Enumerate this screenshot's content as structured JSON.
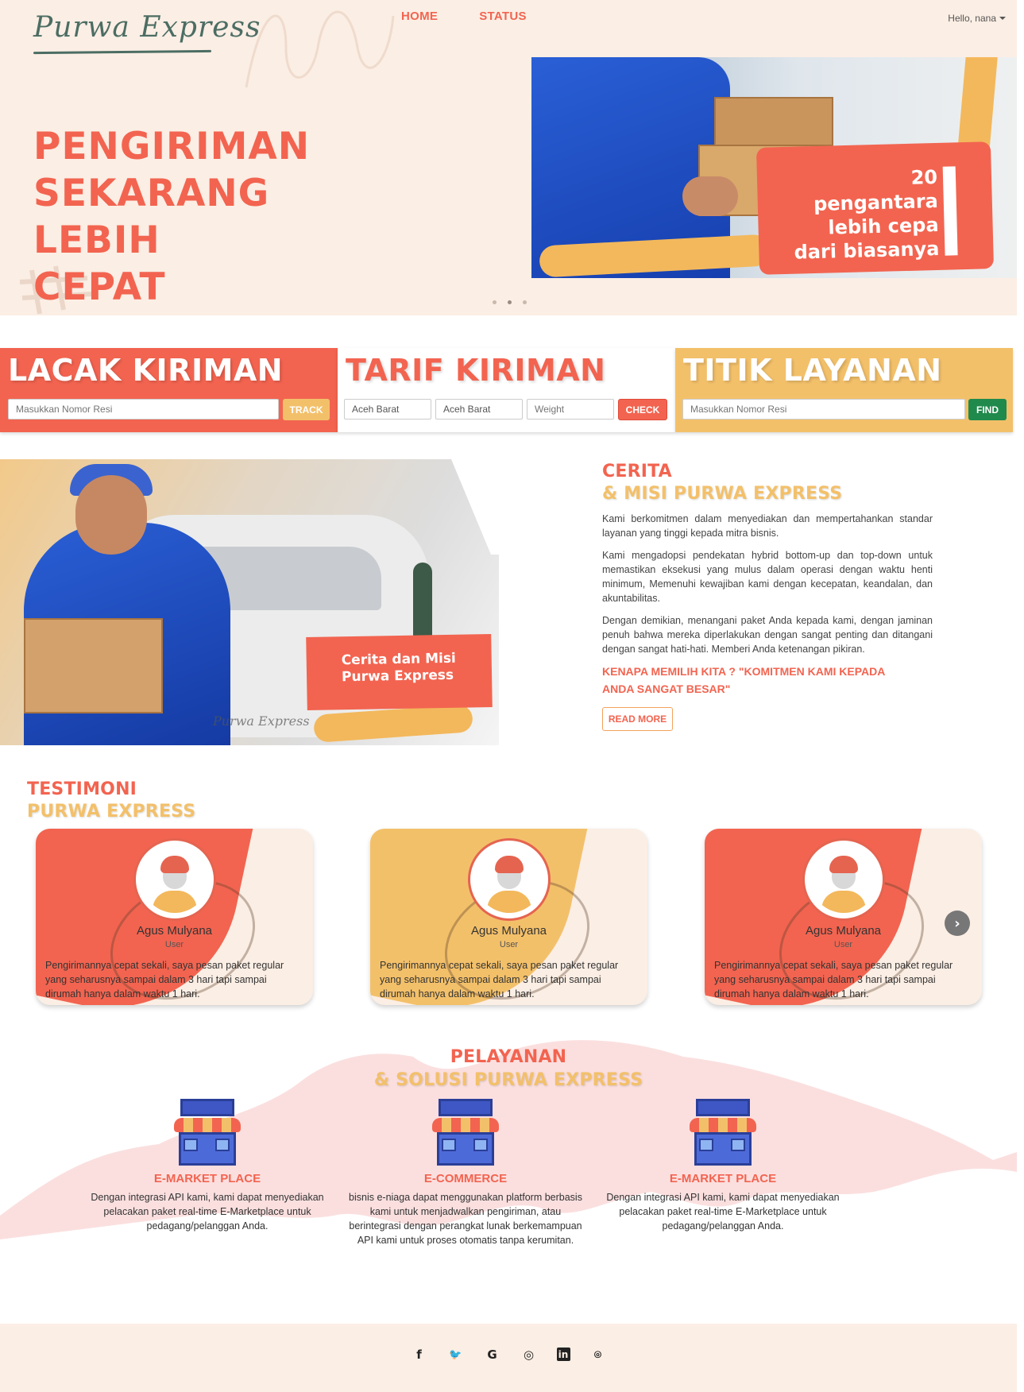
{
  "header": {
    "logo_text": "Purwa Express",
    "nav": [
      "HOME",
      "STATUS"
    ],
    "user_greeting": "Hello, nana"
  },
  "hero": {
    "title_lines": [
      "PENGIRIMAN",
      "SEKARANG LEBIH",
      "CEPAT"
    ],
    "card_text": "20\npengantara\nlebih cepa\ndari biasanya",
    "carousel_count": 3,
    "carousel_active": 1
  },
  "services": {
    "track": {
      "title": "LACAK KIRIMAN",
      "placeholder": "Masukkan Nomor Resi",
      "button": "TRACK"
    },
    "tarif": {
      "title": "TARIF KIRIMAN",
      "origin": "Aceh Barat",
      "destination": "Aceh Barat",
      "weight_placeholder": "Weight",
      "button": "CHECK"
    },
    "titik": {
      "title": "TITIK LAYANAN",
      "placeholder": "Masukkan Nomor Resi",
      "button": "FIND"
    }
  },
  "story": {
    "image_caption": "Cerita dan Misi\nPurwa Express",
    "image_signature": "Purwa Express",
    "title_line1": "CERITA",
    "title_line2": "& MISI PURWA EXPRESS",
    "paragraphs": [
      "Kami berkomitmen dalam menyediakan dan mempertahankan standar layanan yang tinggi kepada mitra bisnis.",
      "Kami mengadopsi pendekatan hybrid bottom-up dan top-down untuk memastikan eksekusi yang mulus dalam operasi dengan waktu henti minimum, Memenuhi kewajiban kami dengan kecepatan, keandalan, dan akuntabilitas.",
      "Dengan demikian, menangani paket Anda kepada kami, dengan jaminan penuh bahwa mereka diperlakukan dengan sangat penting dan ditangani dengan sangat hati-hati. Memberi Anda ketenangan pikiran."
    ],
    "why": "KENAPA MEMILIH KITA ? \"KOMITMEN KAMI KEPADA ANDA SANGAT BESAR\"",
    "read_more": "READ MORE"
  },
  "testimoni": {
    "title_line1": "TESTIMONI",
    "title_line2": "PURWA EXPRESS",
    "items": [
      {
        "name": "Agus Mulyana",
        "role": "User",
        "quote": "Pengirimannya cepat sekali, saya pesan paket regular yang seharusnya sampai dalam 3 hari tapi sampai dirumah hanya dalam waktu 1 hari.",
        "color": "#f26450"
      },
      {
        "name": "Agus Mulyana",
        "role": "User",
        "quote": "Pengirimannya cepat sekali, saya pesan paket regular yang seharusnya sampai dalam 3 hari tapi sampai dirumah hanya dalam waktu 1 hari.",
        "color": "#f3c06a"
      },
      {
        "name": "Agus Mulyana",
        "role": "User",
        "quote": "Pengirimannya cepat sekali, saya pesan paket regular yang seharusnya sampai dalam 3 hari tapi sampai dirumah hanya dalam waktu 1 hari.",
        "color": "#f26450"
      }
    ],
    "next_icon": "chevron-right-icon"
  },
  "pelayanan": {
    "title_line1": "PELAYANAN",
    "title_line2": "& SOLUSI PURWA EXPRESS",
    "items": [
      {
        "title": "E-MARKET PLACE",
        "desc": "Dengan integrasi API kami, kami dapat menyediakan pelacakan paket real-time E-Marketplace untuk pedagang/pelanggan Anda."
      },
      {
        "title": "E-COMMERCE",
        "desc": "bisnis e-niaga dapat menggunakan platform berbasis kami untuk menjadwalkan pengiriman, atau berintegrasi dengan perangkat lunak berkemampuan API kami untuk proses otomatis tanpa kerumitan."
      },
      {
        "title": "E-MARKET PLACE",
        "desc": "Dengan integrasi API kami, kami dapat menyediakan pelacakan paket real-time E-Marketplace untuk pedagang/pelanggan Anda."
      }
    ]
  },
  "footer": {
    "social": [
      {
        "icon": "facebook-icon",
        "glyph": "f"
      },
      {
        "icon": "twitter-icon",
        "glyph": "🐦"
      },
      {
        "icon": "google-icon",
        "glyph": "G"
      },
      {
        "icon": "instagram-icon",
        "glyph": "◎"
      },
      {
        "icon": "linkedin-icon",
        "glyph": "in"
      },
      {
        "icon": "github-icon",
        "glyph": "⌾"
      }
    ]
  },
  "colors": {
    "primary": "#f26450",
    "accent": "#f3c06a",
    "find_button": "#1f8a4c",
    "hero_bg": "#fbeee4"
  }
}
